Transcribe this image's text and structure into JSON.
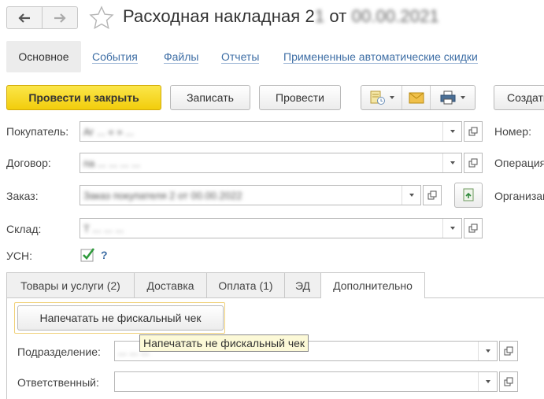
{
  "header": {
    "title_prefix": "Расходная накладная 2",
    "title_number": "1",
    "title_from": "от",
    "title_date": "00.00.2021"
  },
  "subtabs": {
    "main": "Основное",
    "events": "События",
    "files": "Файлы",
    "reports": "Отчеты",
    "discounts": "Примененные автоматические скидки"
  },
  "toolbar": {
    "post_close": "Провести и закрыть",
    "save": "Записать",
    "post": "Провести",
    "create_based": "Создать на основании"
  },
  "form": {
    "buyer_label": "Покупатель:",
    "buyer_value": "Аг              ...  «  »  ...",
    "contract_label": "Договор:",
    "contract_value": "па  ...  ...  ...  ...",
    "order_label": "Заказ:",
    "order_value": "Заказ покупателя 2      от 00.00.2022",
    "warehouse_label": "Склад:",
    "warehouse_value": "Т             ...  ...  ...",
    "usn_label": "УСН:",
    "usn_help": "?",
    "number_label": "Номер:",
    "operation_label": "Операция:",
    "org_label": "Организация:"
  },
  "tabs": {
    "goods": "Товары и услуги (2)",
    "delivery": "Доставка",
    "payment": "Оплата (1)",
    "ed": "ЭД",
    "extra": "Дополнительно"
  },
  "extra": {
    "print_button": "Напечатать не фискальный чек",
    "tooltip": "Напечатать не фискальный чек",
    "division_label": "Подразделение:",
    "division_value": "...  ...  ...",
    "responsible_label": "Ответственный:",
    "responsible_value": ""
  },
  "colors": {
    "accent_yellow": "#f2cd0c",
    "link_blue": "#3e6ea5",
    "check_green": "#2f9a3c",
    "tooltip_bg": "#fcf9d7"
  }
}
